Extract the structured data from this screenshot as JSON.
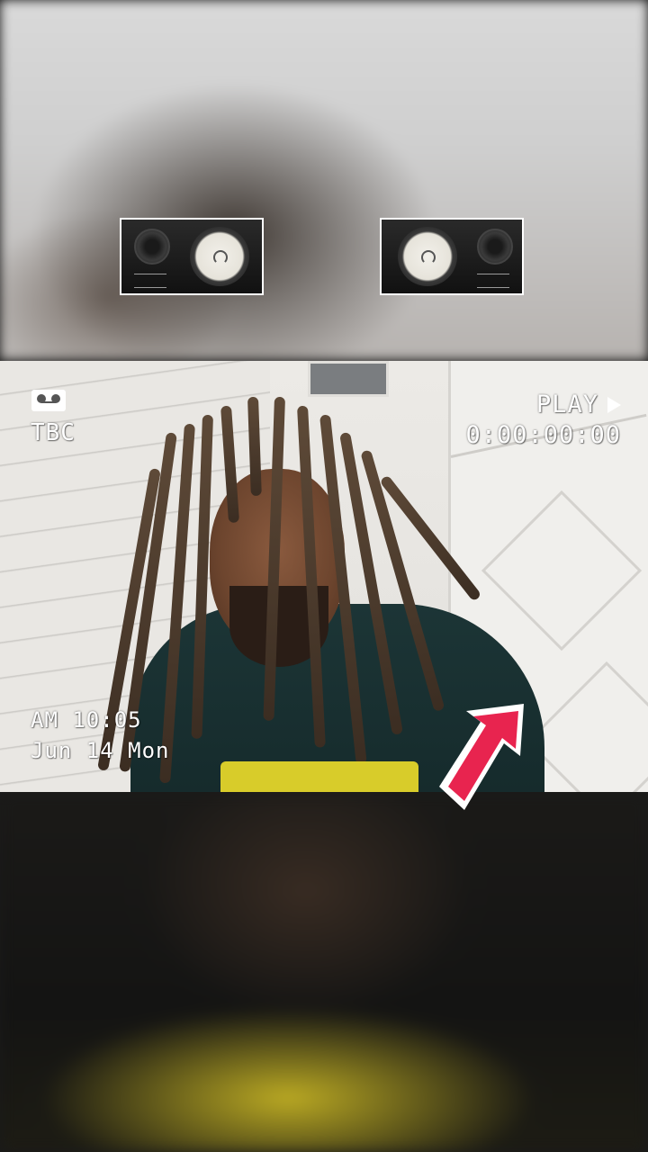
{
  "vhs_overlay": {
    "top_left": {
      "icon": "cassette-tape-icon",
      "label": "TBC"
    },
    "top_right": {
      "mode": "PLAY",
      "mode_icon": "play-triangle-icon",
      "timecode": "0:00:00:00"
    },
    "bottom_left": {
      "time": "AM 10:05",
      "date": "Jun 14 Mon"
    }
  },
  "decorations": {
    "left_speaker_icon": "studio-monitor-speaker-icon",
    "right_speaker_icon": "studio-monitor-speaker-icon",
    "arrow_icon": "pointer-arrow-icon",
    "arrow_color": "#e8244f"
  },
  "colors": {
    "overlay_text": "#ffffff",
    "shirt_print": "#d8cc2a"
  }
}
